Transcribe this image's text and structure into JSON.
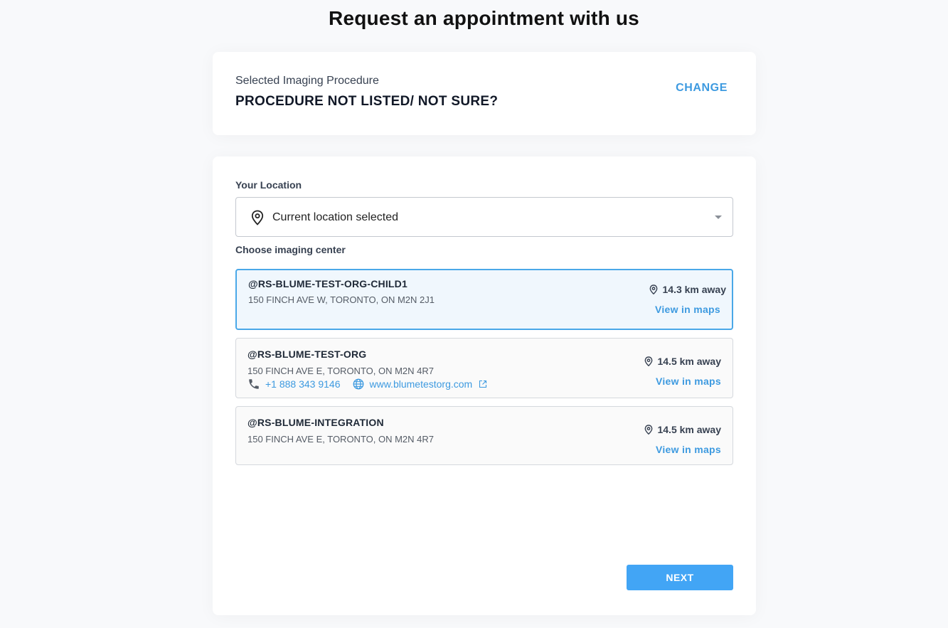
{
  "header": {
    "title": "Request an appointment with us"
  },
  "procedure": {
    "label": "Selected Imaging Procedure",
    "value": "PROCEDURE NOT LISTED/ NOT SURE?",
    "change_label": "CHANGE"
  },
  "location": {
    "label": "Your Location",
    "selected_value": "Current location selected",
    "icon": "location-pin-icon"
  },
  "centers": {
    "label": "Choose imaging center",
    "items": [
      {
        "name": "@RS-BLUME-TEST-ORG-CHILD1",
        "address": "150 FINCH AVE W, TORONTO, ON M2N 2J1",
        "distance": "14.3 km away",
        "maps_label": "View in maps",
        "selected": true
      },
      {
        "name": "@RS-BLUME-TEST-ORG",
        "address": "150 FINCH AVE E, TORONTO, ON M2N 4R7",
        "phone": "+1 888 343 9146",
        "website": "www.blumetestorg.com",
        "distance": "14.5 km away",
        "maps_label": "View in maps",
        "selected": false
      },
      {
        "name": "@RS-BLUME-INTEGRATION",
        "address": "150 FINCH AVE E, TORONTO, ON M2N 4R7",
        "distance": "14.5 km away",
        "maps_label": "View in maps",
        "selected": false
      }
    ]
  },
  "footer": {
    "next_label": "NEXT"
  },
  "colors": {
    "accent": "#3d9ae0",
    "button": "#42a5f5",
    "selected_border": "#4aa8e8",
    "selected_bg": "#f0f7fd"
  }
}
